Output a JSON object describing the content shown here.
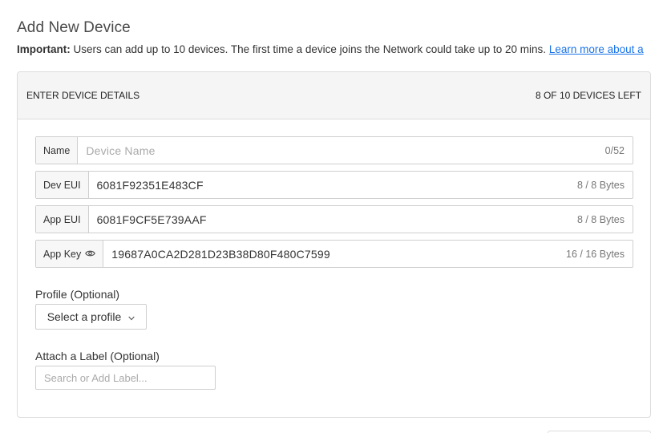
{
  "page": {
    "title": "Add New Device",
    "notice_strong": "Important:",
    "notice_text": " Users can add up to 10 devices. The first time a device joins the Network could take up to 20 mins. ",
    "notice_link": "Learn more about a"
  },
  "panel": {
    "header_title": "ENTER DEVICE DETAILS",
    "devices_left": "8 OF 10 DEVICES LEFT"
  },
  "fields": {
    "name": {
      "label": "Name",
      "placeholder": "Device Name",
      "value": "",
      "counter": "0/52"
    },
    "dev_eui": {
      "label": "Dev EUI",
      "value": "6081F92351E483CF",
      "counter": "8 / 8 Bytes"
    },
    "app_eui": {
      "label": "App EUI",
      "value": "6081F9CF5E739AAF",
      "counter": "8 / 8 Bytes"
    },
    "app_key": {
      "label": "App Key",
      "icon": "eye-icon",
      "value": "19687A0CA2D281D23B38D80F480C7599",
      "counter": "16 / 16 Bytes"
    }
  },
  "profile": {
    "label": "Profile (Optional)",
    "select_label": "Select a profile",
    "icon": "chevron-down-icon"
  },
  "attach_label": {
    "label": "Attach a Label (Optional)",
    "placeholder": "Search or Add Label..."
  },
  "colors": {
    "link": "#1a73e8",
    "header_bg": "#f5f5f5",
    "border": "#cfcfcf"
  }
}
